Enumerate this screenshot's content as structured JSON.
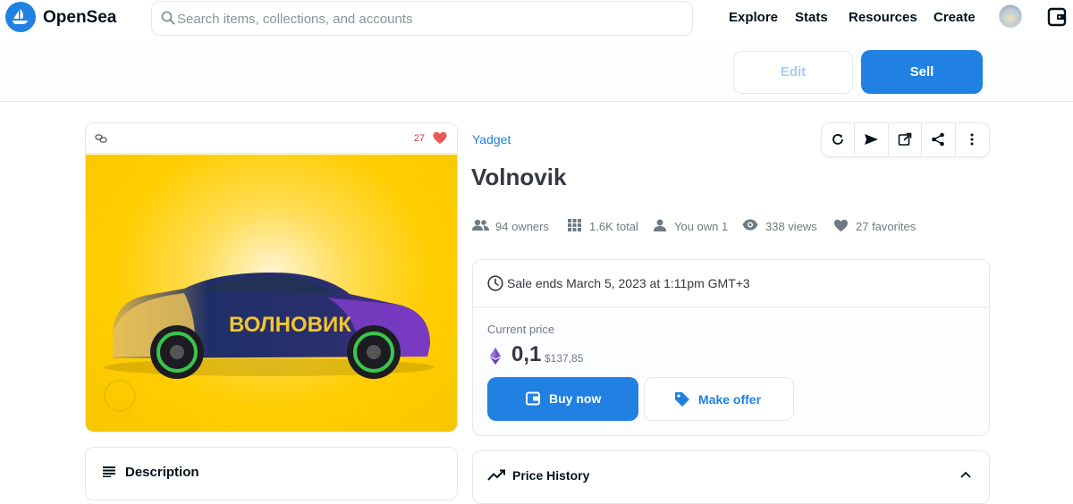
{
  "nav": {
    "brand": "OpenSea",
    "search_placeholder": "Search items, collections, and accounts",
    "links": [
      "Explore",
      "Stats",
      "Resources",
      "Create"
    ]
  },
  "actions": {
    "edit_label": "Edit",
    "sell_label": "Sell"
  },
  "asset": {
    "favorites_count": "27",
    "collection": "Yadget",
    "name": "Volnovik",
    "stats": {
      "owners": "94 owners",
      "total": "1.6K total",
      "you_own": "You own 1",
      "views": "338 views",
      "favorites": "27 favorites"
    }
  },
  "sale": {
    "ends": "Sale ends March 5, 2023 at 1:11pm GMT+3",
    "current_price_label": "Current price",
    "price": "0,1",
    "usd": "$137,85",
    "buy_label": "Buy now",
    "offer_label": "Make offer"
  },
  "sections": {
    "description": "Description",
    "price_history": "Price History"
  },
  "icons": {
    "toolbar": [
      "refresh-icon",
      "send-icon",
      "external-link-icon",
      "share-icon",
      "more-vertical-icon"
    ]
  },
  "colors": {
    "accent": "#2081e2",
    "text": "#04111d",
    "muted": "#707a83",
    "heart": "#eb5757",
    "artwork_bg": "#ffcd00"
  }
}
